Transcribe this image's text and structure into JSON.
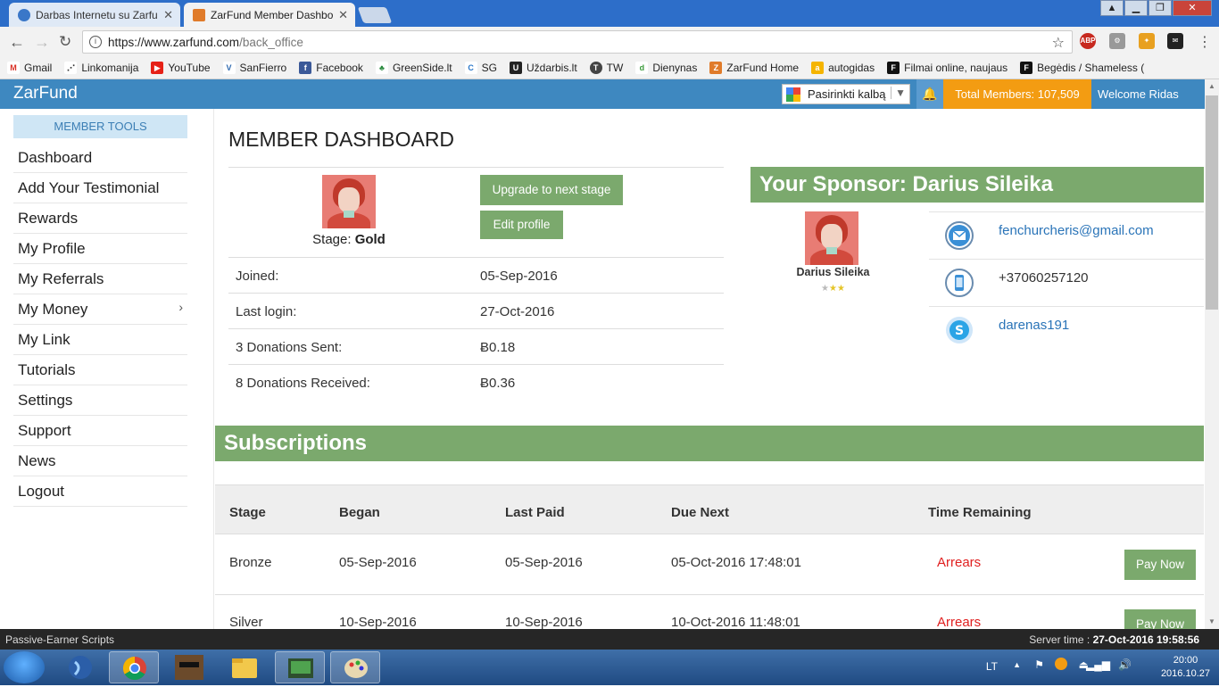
{
  "browser": {
    "tabs": [
      {
        "label": "Darbas Internetu su Zarfu",
        "active": false
      },
      {
        "label": "ZarFund Member Dashbo",
        "active": true
      }
    ],
    "url_host": "https://www.zarfund.com",
    "url_path": "/back_office",
    "bookmarks": [
      "Gmail",
      "Linkomanija",
      "YouTube",
      "SanFierro",
      "Facebook",
      "GreenSide.lt",
      "SG",
      "Uždarbis.lt",
      "TW",
      "Dienynas",
      "ZarFund Home",
      "autogidas",
      "Filmai online, naujaus",
      "Begėdis / Shameless ("
    ]
  },
  "topnav": {
    "brand": "ZarFund",
    "language_select": "Pasirinkti kalbą",
    "total_members": "Total Members: 107,509",
    "welcome": "Welcome Ridas"
  },
  "sidebar": {
    "header": "MEMBER TOOLS",
    "items": [
      "Dashboard",
      "Add Your Testimonial",
      "Rewards",
      "My Profile",
      "My Referrals",
      "My Money",
      "My Link",
      "Tutorials",
      "Settings",
      "Support",
      "News",
      "Logout"
    ]
  },
  "dashboard": {
    "title": "MEMBER DASHBOARD",
    "stage_prefix": "Stage:",
    "stage_value": "Gold",
    "upgrade_button": "Upgrade to next stage",
    "edit_button": "Edit profile",
    "rows": [
      {
        "label": "Joined:",
        "value": "05-Sep-2016"
      },
      {
        "label": "Last login:",
        "value": "27-Oct-2016"
      },
      {
        "label": "3 Donations Sent:",
        "value": "Ƀ0.18"
      },
      {
        "label": "8 Donations Received:",
        "value": "Ƀ0.36"
      }
    ]
  },
  "sponsor": {
    "heading": "Your Sponsor: Darius Sileika",
    "name": "Darius Sileika",
    "stars_filled": 2,
    "stars_total": 3,
    "email": "fenchurcheris@gmail.com",
    "phone": "+37060257120",
    "skype": "darenas191"
  },
  "subscriptions": {
    "heading": "Subscriptions",
    "columns": [
      "Stage",
      "Began",
      "Last Paid",
      "Due Next",
      "Time Remaining"
    ],
    "rows": [
      {
        "stage": "Bronze",
        "began": "05-Sep-2016",
        "last_paid": "05-Sep-2016",
        "due_next": "05-Oct-2016 17:48:01",
        "remaining": "Arrears",
        "action": "Pay Now"
      },
      {
        "stage": "Silver",
        "began": "10-Sep-2016",
        "last_paid": "10-Sep-2016",
        "due_next": "10-Oct-2016 11:48:01",
        "remaining": "Arrears",
        "action": "Pay Now"
      }
    ]
  },
  "footer": {
    "left": "Passive-Earner Scripts",
    "server_label": "Server time :",
    "server_time": "27-Oct-2016 19:58:56"
  },
  "taskbar": {
    "lang": "LT",
    "time": "20:00",
    "date": "2016.10.27"
  },
  "colors": {
    "nav_blue": "#3e88c0",
    "accent_orange": "#f39c12",
    "section_green": "#7ba96d",
    "arrears_red": "#e02020"
  }
}
